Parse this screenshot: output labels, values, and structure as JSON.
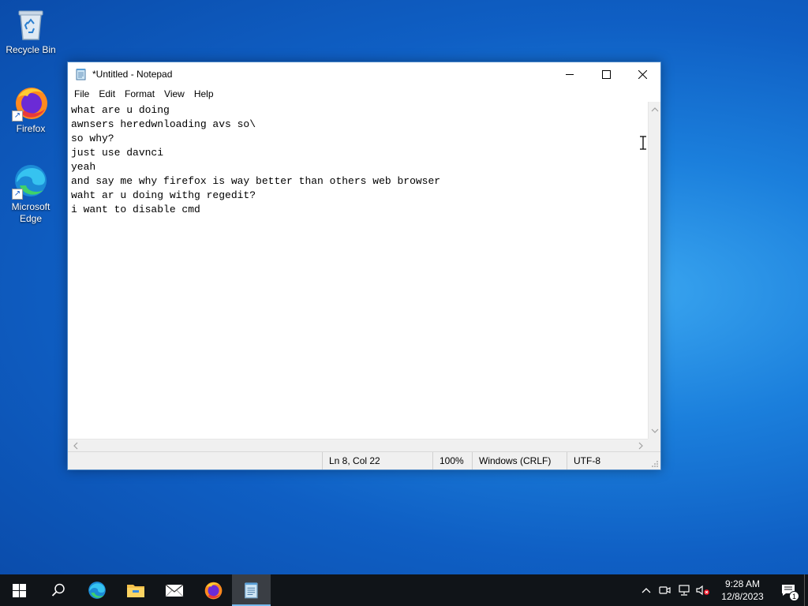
{
  "desktop": {
    "icons": [
      {
        "label": "Recycle Bin"
      },
      {
        "label": "Firefox"
      },
      {
        "label": "Microsoft Edge"
      }
    ]
  },
  "notepad": {
    "title": "*Untitled - Notepad",
    "menu": [
      "File",
      "Edit",
      "Format",
      "View",
      "Help"
    ],
    "lines": [
      "what are u doing",
      "awnsers heredwnloading avs so\\",
      "so why?",
      "just use davnci",
      "yeah",
      "and say me why firefox is way better than others web browser",
      "waht ar u doing withg regedit?",
      "i want to disable cmd"
    ],
    "status": {
      "position": "Ln 8, Col 22",
      "zoom": "100%",
      "line_ending": "Windows (CRLF)",
      "encoding": "UTF-8"
    }
  },
  "taskbar": {
    "apps": [
      "start-icon",
      "search-icon",
      "edge-icon",
      "file-explorer-icon",
      "mail-icon",
      "firefox-icon",
      "notepad-icon"
    ],
    "clock": {
      "time": "9:28 AM",
      "date": "12/8/2023"
    },
    "notification_count": "1"
  },
  "colors": {
    "accent": "#0078d7",
    "taskbar_bg": "#101418"
  }
}
